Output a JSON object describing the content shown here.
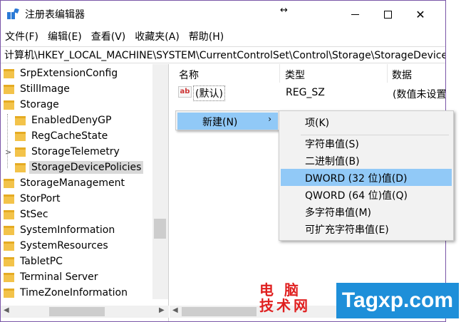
{
  "window": {
    "title": "注册表编辑器",
    "controls": {
      "minimize": "—",
      "maximize": "☐",
      "close": "✕"
    }
  },
  "menu": [
    "文件(F)",
    "编辑(E)",
    "查看(V)",
    "收藏夹(A)",
    "帮助(H)"
  ],
  "address": "计算机\\HKEY_LOCAL_MACHINE\\SYSTEM\\CurrentControlSet\\Control\\Storage\\StorageDevicePolicies",
  "tree": [
    {
      "label": "SrpExtensionConfig",
      "indent": 0
    },
    {
      "label": "StillImage",
      "indent": 0
    },
    {
      "label": "Storage",
      "indent": 0
    },
    {
      "label": "EnabledDenyGP",
      "indent": 1
    },
    {
      "label": "RegCacheState",
      "indent": 1
    },
    {
      "label": "StorageTelemetry",
      "indent": 1,
      "expandable": true
    },
    {
      "label": "StorageDevicePolicies",
      "indent": 1,
      "selected": true
    },
    {
      "label": "StorageManagement",
      "indent": 0
    },
    {
      "label": "StorPort",
      "indent": 0
    },
    {
      "label": "StSec",
      "indent": 0
    },
    {
      "label": "SystemInformation",
      "indent": 0
    },
    {
      "label": "SystemResources",
      "indent": 0
    },
    {
      "label": "TabletPC",
      "indent": 0
    },
    {
      "label": "Terminal Server",
      "indent": 0
    },
    {
      "label": "TimeZoneInformation",
      "indent": 0
    }
  ],
  "list": {
    "headers": {
      "name": "名称",
      "type": "类型",
      "data": "数据"
    },
    "rows": [
      {
        "icon": "ab",
        "name": "(默认)",
        "type": "REG_SZ",
        "data": "(数值未设置)"
      }
    ]
  },
  "context_menu": {
    "new_label": "新建(N)",
    "submenu": [
      {
        "label": "项(K)"
      },
      {
        "label": "字符串值(S)"
      },
      {
        "label": "二进制值(B)"
      },
      {
        "label": "DWORD (32 位)值(D)",
        "highlighted": true
      },
      {
        "label": "QWORD (64 位)值(Q)"
      },
      {
        "label": "多字符串值(M)"
      },
      {
        "label": "可扩充字符串值(E)"
      }
    ]
  },
  "watermark": {
    "cn": "电 脑\n技术网",
    "en": "Tagxp.com"
  },
  "colors": {
    "highlight": "#91c9f7",
    "folder": "#f3c34a",
    "window_border": "#7a56a8",
    "watermark_red": "#e02020",
    "watermark_blue": "#1e8fd9"
  }
}
